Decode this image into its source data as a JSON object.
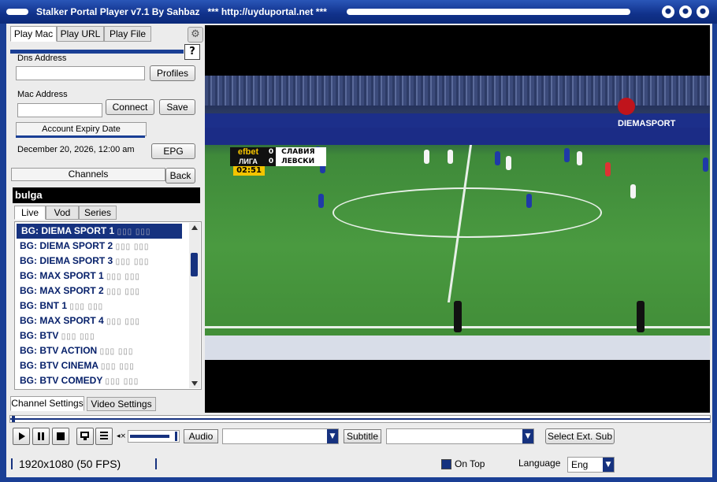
{
  "window": {
    "title": "Stalker Portal Player v7.1 By Sahbaz",
    "subtitle": "*** http://uyduportal.net ***"
  },
  "tabs": [
    "Play Mac",
    "Play URL",
    "Play File"
  ],
  "dns": {
    "label": "Dns Address",
    "value": "",
    "profiles_button": "Profiles"
  },
  "mac": {
    "label": "Mac Address",
    "value": "",
    "connect_button": "Connect",
    "save_button": "Save"
  },
  "expiry": {
    "label": "Account Expiry Date",
    "value": "December 20, 2026, 12:00 am",
    "epg_button": "EPG"
  },
  "channels": {
    "header": "Channels",
    "back_button": "Back",
    "search": "bulga"
  },
  "subtabs": [
    "Live",
    "Vod",
    "Series"
  ],
  "channel_list": [
    {
      "name": "BG: DIEMA SPORT 1",
      "glyph": "▯▯▯ ▯▯▯"
    },
    {
      "name": "BG: DIEMA SPORT 2",
      "glyph": "▯▯▯ ▯▯▯"
    },
    {
      "name": "BG: DIEMA SPORT 3",
      "glyph": "▯▯▯ ▯▯▯"
    },
    {
      "name": "BG: MAX SPORT 1",
      "glyph": "▯▯▯ ▯▯▯"
    },
    {
      "name": "BG: MAX SPORT 2",
      "glyph": "▯▯▯ ▯▯▯"
    },
    {
      "name": "BG: BNT 1",
      "glyph": "▯▯▯ ▯▯▯"
    },
    {
      "name": "BG: MAX SPORT 4",
      "glyph": "▯▯▯ ▯▯▯"
    },
    {
      "name": "BG: BTV",
      "glyph": "▯▯▯ ▯▯▯"
    },
    {
      "name": "BG: BTV ACTION",
      "glyph": "▯▯▯ ▯▯▯"
    },
    {
      "name": "BG: BTV CINEMA",
      "glyph": "▯▯▯ ▯▯▯"
    },
    {
      "name": "BG: BTV COMEDY",
      "glyph": "▯▯▯ ▯▯▯"
    }
  ],
  "settings_tabs": [
    "Channel Settings",
    "Video Settings"
  ],
  "scoreboard": {
    "sponsor": "efbet",
    "league": "ЛИГА",
    "time": "02:51",
    "team1": "СЛАВИЯ",
    "score1": "0",
    "team2": "ЛЕВСКИ",
    "score2": "0"
  },
  "broadcaster": "DIEMASPORT",
  "controls": {
    "audio_label": "Audio",
    "subtitle_label": "Subtitle",
    "select_ext_sub": "Select Ext. Sub",
    "volume_level": 0.9
  },
  "status": {
    "resolution": "1920x1080",
    "fps": "(50 FPS)",
    "on_top": "On Top",
    "language_label": "Language",
    "language_value": "Eng"
  }
}
